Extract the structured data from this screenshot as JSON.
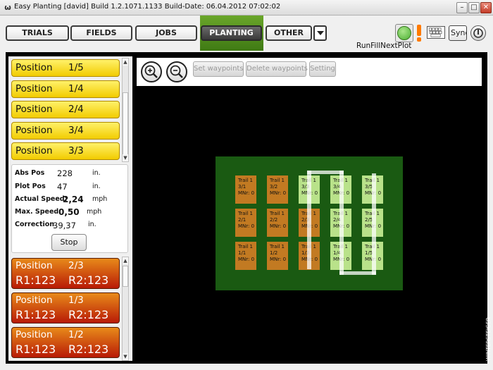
{
  "window": {
    "title": "Easy Planting [david] Build 1.2.1071.1133  Build-Date: 06.04.2012 07:02:02",
    "app_icon": "ω"
  },
  "nav": {
    "trials": "TRIALS",
    "fields": "FIELDS",
    "jobs": "JOBS",
    "planting": "PLANTING",
    "other": "OTHER"
  },
  "toolbar": {
    "sync_label": "Sync",
    "run_label": "RunFillNextPlot"
  },
  "positions_top": [
    {
      "label": "Position",
      "value": "1/5"
    },
    {
      "label": "Position",
      "value": "1/4"
    },
    {
      "label": "Position",
      "value": "2/4"
    },
    {
      "label": "Position",
      "value": "3/4"
    },
    {
      "label": "Position",
      "value": "3/3"
    }
  ],
  "info": {
    "abs_pos_label": "Abs Pos",
    "abs_pos_value": "228",
    "abs_pos_unit": "in.",
    "plot_pos_label": "Plot Pos",
    "plot_pos_value": "47",
    "plot_pos_unit": "in.",
    "actual_speed_label": "Actual Speed:",
    "actual_speed_value": "2,24",
    "actual_speed_unit": "mph",
    "max_speed_label": "Max. Speed:",
    "max_speed_value": "0,50",
    "max_speed_unit": "mph",
    "correction_label": "Correction",
    "correction_value": "39,37",
    "correction_unit": "in.",
    "stop_label": "Stop"
  },
  "positions_bottom": [
    {
      "label": "Position",
      "value": "2/3",
      "r1": "R1:123",
      "r2": "R2:123"
    },
    {
      "label": "Position",
      "value": "1/3",
      "r1": "R1:123",
      "r2": "R2:123"
    },
    {
      "label": "Position",
      "value": "1/2",
      "r1": "R1:123",
      "r2": "R2:123"
    }
  ],
  "map_toolbar": {
    "set_waypoints": "Set waypoints",
    "delete_waypoints": "Delete waypoints",
    "setting": "Setting"
  },
  "plots": [
    {
      "l1": "Trail 1",
      "l2": "3/1",
      "l3": "MNr: 0",
      "state": "brown"
    },
    {
      "l1": "Trail 1",
      "l2": "3/2",
      "l3": "MNr: 0",
      "state": "brown"
    },
    {
      "l1": "Trail 1",
      "l2": "3/3",
      "l3": "MNr: 0",
      "state": "light"
    },
    {
      "l1": "Trail 1",
      "l2": "3/4",
      "l3": "MNr: 0",
      "state": "light"
    },
    {
      "l1": "Trail 1",
      "l2": "3/5",
      "l3": "MNr: 0",
      "state": "light"
    },
    {
      "l1": "Trail 1",
      "l2": "2/1",
      "l3": "MNr: 0",
      "state": "brown"
    },
    {
      "l1": "Trail 1",
      "l2": "2/2",
      "l3": "MNr: 0",
      "state": "brown"
    },
    {
      "l1": "Trail 1",
      "l2": "2/3",
      "l3": "MNr: 0",
      "state": "brown"
    },
    {
      "l1": "Trail 1",
      "l2": "2/4",
      "l3": "MNr: 0",
      "state": "light"
    },
    {
      "l1": "Trail 1",
      "l2": "2/5",
      "l3": "MNr: 0",
      "state": "light"
    },
    {
      "l1": "Trail 1",
      "l2": "1/1",
      "l3": "MNr: 0",
      "state": "brown"
    },
    {
      "l1": "Trail 1",
      "l2": "1/2",
      "l3": "MNr: 0",
      "state": "brown"
    },
    {
      "l1": "Trail 1",
      "l2": "1/3",
      "l3": "MNr: 0",
      "state": "brown"
    },
    {
      "l1": "Trail 1",
      "l2": "1/4",
      "l3": "MNr: 0",
      "state": "light"
    },
    {
      "l1": "Trail 1",
      "l2": "1/5",
      "l3": "MNr: 0",
      "state": "light"
    }
  ],
  "brand": "WINTERSTEIGER",
  "colors": {
    "active_tab": "#4f8c1e",
    "position_yellow": "#f5d600",
    "position_red": "#c8300a",
    "field_green": "#1a5a12",
    "plot_planted": "#c27a22",
    "plot_open": "#b9e28a"
  }
}
